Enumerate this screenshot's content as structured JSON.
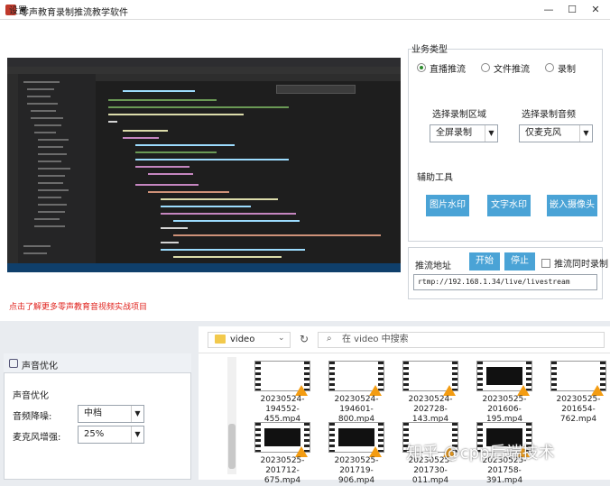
{
  "window": {
    "title": "零声教育录制推流教学软件",
    "min": "—",
    "max": "☐",
    "close": "✕"
  },
  "menu": {
    "settings": "设置"
  },
  "promo_text": "点击了解更多零声教育音视频实战项目",
  "business_type": {
    "label": "业务类型",
    "options": [
      "直播推流",
      "文件推流",
      "录制"
    ],
    "selected": 0
  },
  "capture": {
    "region_label": "选择录制区域",
    "region_value": "全屏录制",
    "audio_label": "选择录制音频",
    "audio_value": "仅麦克风"
  },
  "tools": {
    "label": "辅助工具",
    "buttons": [
      "图片水印",
      "文字水印",
      "嵌入摄像头"
    ]
  },
  "stream": {
    "label": "推流地址",
    "start": "开始",
    "stop": "停止",
    "record_checkbox": "推流同时录制",
    "url": "rtmp://192.168.1.34/live/livestream"
  },
  "sound": {
    "title": "声音优化",
    "subtitle": "声音优化",
    "noise_label": "音频降噪:",
    "noise_value": "中档",
    "gain_label": "麦克风增强:",
    "gain_value": "25%"
  },
  "explorer": {
    "path": "video",
    "search_placeholder": "在 video 中搜索",
    "files": [
      {
        "name": "20230524-194552-455.mp4",
        "dark": false
      },
      {
        "name": "20230524-194601-800.mp4",
        "dark": false
      },
      {
        "name": "20230524-202728-143.mp4",
        "dark": false
      },
      {
        "name": "20230525-201606-195.mp4",
        "dark": true
      },
      {
        "name": "20230525-201654-762.mp4",
        "dark": false
      },
      {
        "name": "20230525-201712-675.mp4",
        "dark": true
      },
      {
        "name": "20230525-201719-906.mp4",
        "dark": true
      },
      {
        "name": "20230525-201730-011.mp4",
        "dark": false
      },
      {
        "name": "20230525-201758-391.mp4",
        "dark": true
      }
    ]
  },
  "watermark": "知乎 @cpp后端技术",
  "colors": {
    "accent_button": "#4aa3d6",
    "promo": "#e0231e",
    "radio_selected": "#2e8b2e"
  }
}
